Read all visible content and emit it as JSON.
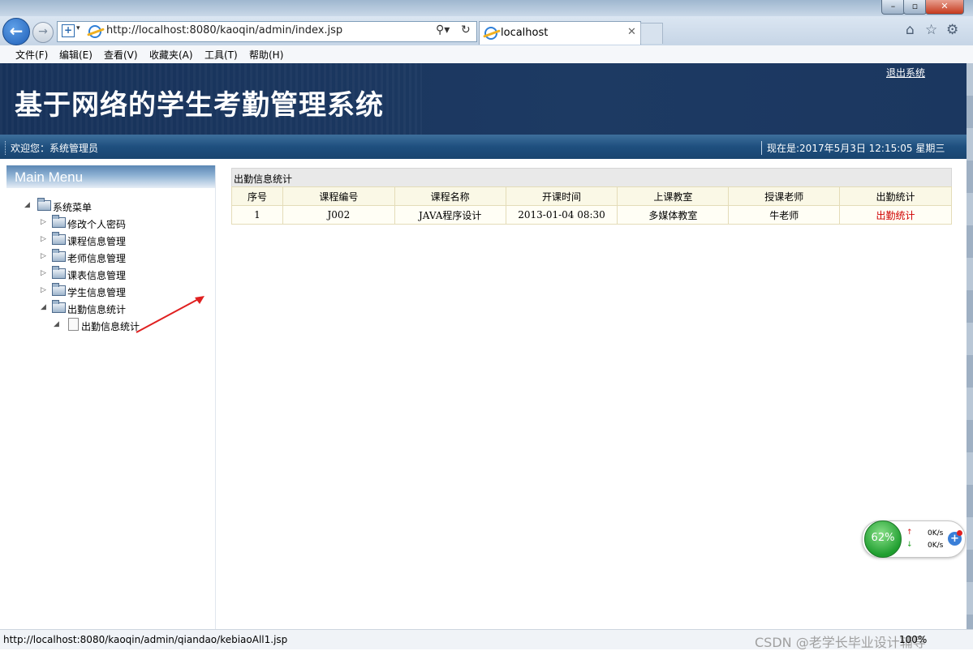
{
  "browser": {
    "url": "http://localhost:8080/kaoqin/admin/index.jsp",
    "tab_title": "localhost",
    "menu": [
      "文件(F)",
      "编辑(E)",
      "查看(V)",
      "收藏夹(A)",
      "工具(T)",
      "帮助(H)"
    ],
    "status_url": "http://localhost:8080/kaoqin/admin/qiandao/kebiaoAll1.jsp",
    "zoom": "100%"
  },
  "header": {
    "logout": "退出系统",
    "title": "基于网络的学生考勤管理系统",
    "welcome": "欢迎您：系统管理员",
    "datetime": "现在是:2017年5月3日 12:15:05 星期三"
  },
  "sidebar": {
    "title": "Main Menu",
    "root": "系统菜单",
    "items": [
      "修改个人密码",
      "课程信息管理",
      "老师信息管理",
      "课表信息管理",
      "学生信息管理",
      "出勤信息统计"
    ],
    "sub_item": "出勤信息统计"
  },
  "panel": {
    "title": "出勤信息统计",
    "columns": [
      "序号",
      "课程编号",
      "课程名称",
      "开课时间",
      "上课教室",
      "授课老师",
      "出勤统计"
    ],
    "rows": [
      [
        "1",
        "J002",
        "JAVA程序设计",
        "2013-01-04 08:30",
        "多媒体教室",
        "牛老师",
        "出勤统计"
      ]
    ]
  },
  "widget": {
    "percent": "62%",
    "up": "0K/s",
    "down": "0K/s"
  },
  "watermark": "CSDN @老学长毕业设计辅导"
}
